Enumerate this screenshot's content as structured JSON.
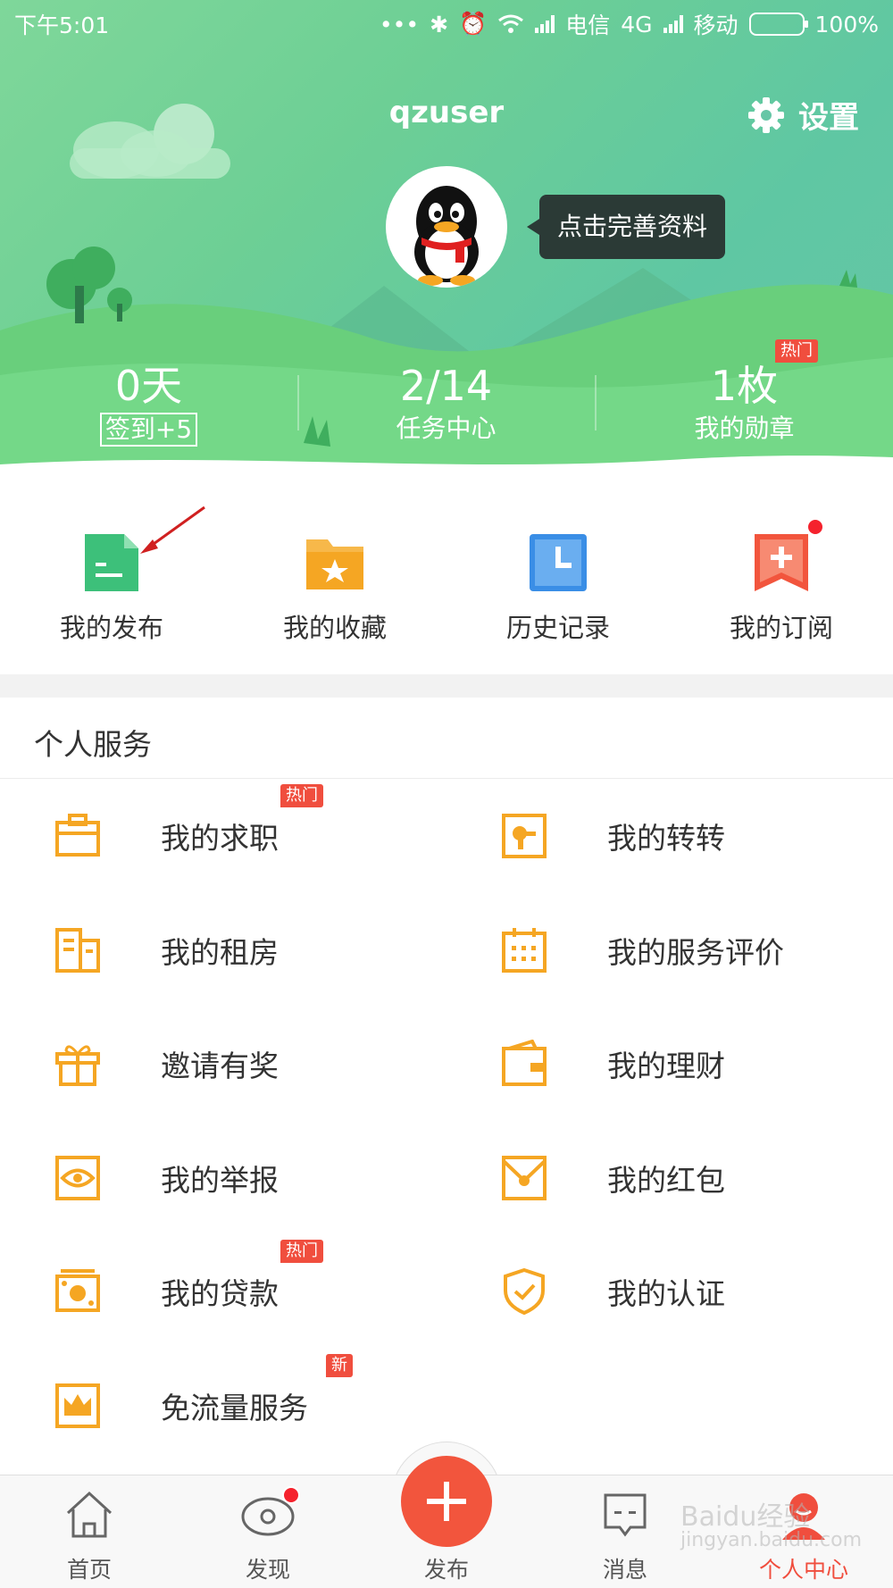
{
  "status_bar": {
    "time": "下午5:01",
    "carrier1": "电信",
    "network": "4G",
    "carrier2": "移动",
    "battery": "100%"
  },
  "header": {
    "username": "qzuser",
    "settings_label": "设置",
    "tooltip": "点击完善资料",
    "stats": [
      {
        "value": "0天",
        "label": "签到+5"
      },
      {
        "value": "2/14",
        "label": "任务中心"
      },
      {
        "value": "1枚",
        "label": "我的勋章",
        "tag": "热门"
      }
    ]
  },
  "quick_actions": [
    {
      "label": "我的发布",
      "icon": "document-icon",
      "color": "#3dc07a"
    },
    {
      "label": "我的收藏",
      "icon": "star-folder-icon",
      "color": "#f5a623"
    },
    {
      "label": "历史记录",
      "icon": "clock-icon",
      "color": "#3a8ee6"
    },
    {
      "label": "我的订阅",
      "icon": "bookmark-plus-icon",
      "color": "#f2553d"
    }
  ],
  "services": {
    "title": "个人服务",
    "items": [
      {
        "label": "我的求职",
        "icon": "briefcase-icon",
        "tag": "热门"
      },
      {
        "label": "我的转转",
        "icon": "trade-icon"
      },
      {
        "label": "我的租房",
        "icon": "building-icon"
      },
      {
        "label": "我的服务评价",
        "icon": "calendar-icon"
      },
      {
        "label": "邀请有奖",
        "icon": "gift-icon"
      },
      {
        "label": "我的理财",
        "icon": "wallet-icon"
      },
      {
        "label": "我的举报",
        "icon": "eye-icon"
      },
      {
        "label": "我的红包",
        "icon": "envelope-icon"
      },
      {
        "label": "我的贷款",
        "icon": "cash-icon",
        "tag": "热门"
      },
      {
        "label": "我的认证",
        "icon": "shield-check-icon"
      },
      {
        "label": "免流量服务",
        "icon": "crown-icon",
        "tag": "新"
      }
    ]
  },
  "tabbar": {
    "items": [
      {
        "label": "首页",
        "icon": "home-icon"
      },
      {
        "label": "发现",
        "icon": "eye-icon"
      },
      {
        "label": "发布",
        "icon": "plus-icon"
      },
      {
        "label": "消息",
        "icon": "message-icon"
      },
      {
        "label": "个人中心",
        "icon": "person-icon"
      }
    ],
    "active_color": "#f04e3e"
  },
  "watermark": {
    "line1": "Baidu经验",
    "line2": "jingyan.baidu.com"
  }
}
